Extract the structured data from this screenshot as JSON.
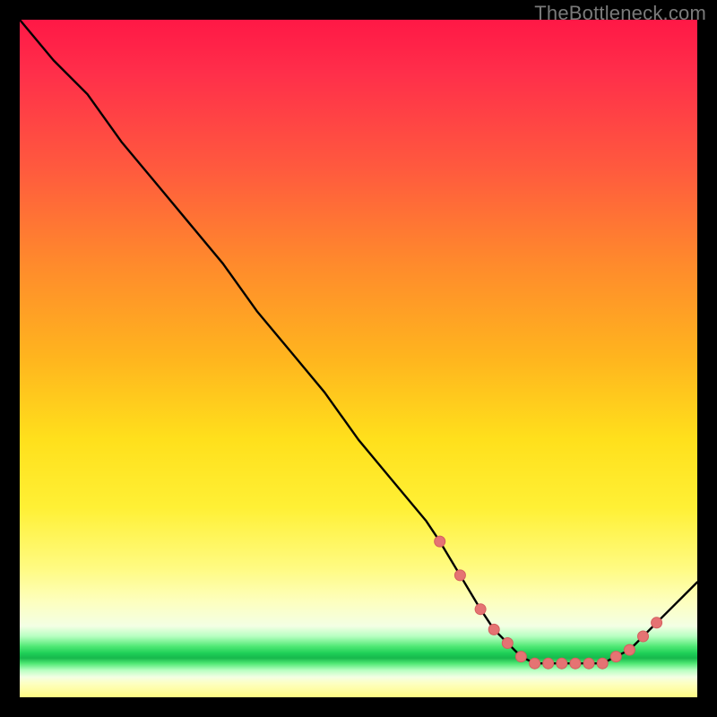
{
  "watermark": "TheBottleneck.com",
  "colors": {
    "background": "#000000",
    "curve_stroke": "#000000",
    "marker_fill": "#e57373",
    "marker_stroke": "#d45e5e",
    "gradient_top": "#ff1846",
    "gradient_mid": "#ffe01c",
    "gradient_green": "#1ecf57"
  },
  "chart_data": {
    "type": "line",
    "title": "",
    "xlabel": "",
    "ylabel": "",
    "xlim": [
      0,
      100
    ],
    "ylim": [
      0,
      100
    ],
    "grid": false,
    "legend": false,
    "series": [
      {
        "name": "bottleneck-curve",
        "x": [
          0,
          5,
          10,
          15,
          20,
          25,
          30,
          35,
          40,
          45,
          50,
          55,
          60,
          62,
          65,
          68,
          70,
          72,
          74,
          76,
          78,
          80,
          82,
          84,
          86,
          88,
          90,
          92,
          94,
          96,
          98,
          100
        ],
        "y": [
          100,
          94,
          89,
          82,
          76,
          70,
          64,
          57,
          51,
          45,
          38,
          32,
          26,
          23,
          18,
          13,
          10,
          8,
          6,
          5,
          5,
          5,
          5,
          5,
          5,
          6,
          7,
          9,
          11,
          13,
          15,
          17
        ]
      }
    ],
    "markers": [
      {
        "x": 62,
        "y": 23
      },
      {
        "x": 65,
        "y": 18
      },
      {
        "x": 68,
        "y": 13
      },
      {
        "x": 70,
        "y": 10
      },
      {
        "x": 72,
        "y": 8
      },
      {
        "x": 74,
        "y": 6
      },
      {
        "x": 76,
        "y": 5
      },
      {
        "x": 78,
        "y": 5
      },
      {
        "x": 80,
        "y": 5
      },
      {
        "x": 82,
        "y": 5
      },
      {
        "x": 84,
        "y": 5
      },
      {
        "x": 86,
        "y": 5
      },
      {
        "x": 88,
        "y": 6
      },
      {
        "x": 90,
        "y": 7
      },
      {
        "x": 92,
        "y": 9
      },
      {
        "x": 94,
        "y": 11
      }
    ]
  }
}
